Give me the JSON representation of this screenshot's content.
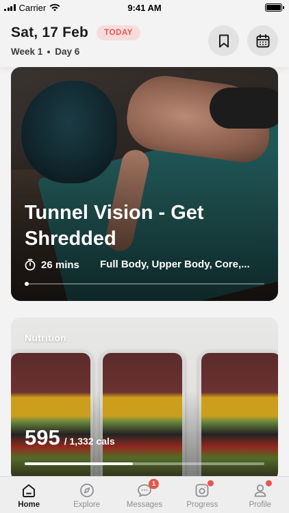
{
  "status_bar": {
    "carrier": "Carrier",
    "time": "9:41 AM"
  },
  "header": {
    "date": "Sat, 17 Feb",
    "today_badge": "TODAY",
    "week": "Week 1",
    "day": "Day 6",
    "bookmark_icon": "bookmark-icon",
    "calendar_icon": "calendar-icon"
  },
  "workout": {
    "title": "Tunnel Vision - Get Shredded",
    "duration": "26 mins",
    "tags": "Full Body, Upper Body, Core,...",
    "progress": 0.0
  },
  "nutrition": {
    "label": "Nutrition",
    "calories_eaten": "595",
    "calories_total": "/ 1,332 cals",
    "progress": 0.45
  },
  "tabs": [
    {
      "label": "Home",
      "icon": "home-icon",
      "active": true
    },
    {
      "label": "Explore",
      "icon": "compass-icon"
    },
    {
      "label": "Messages",
      "icon": "chat-icon",
      "badge": "1"
    },
    {
      "label": "Progress",
      "icon": "camera-icon",
      "dot": true
    },
    {
      "label": "Profile",
      "icon": "profile-icon",
      "dot": true
    }
  ],
  "colors": {
    "accent": "#e4574e",
    "badge_bg": "#f8dcdc"
  }
}
